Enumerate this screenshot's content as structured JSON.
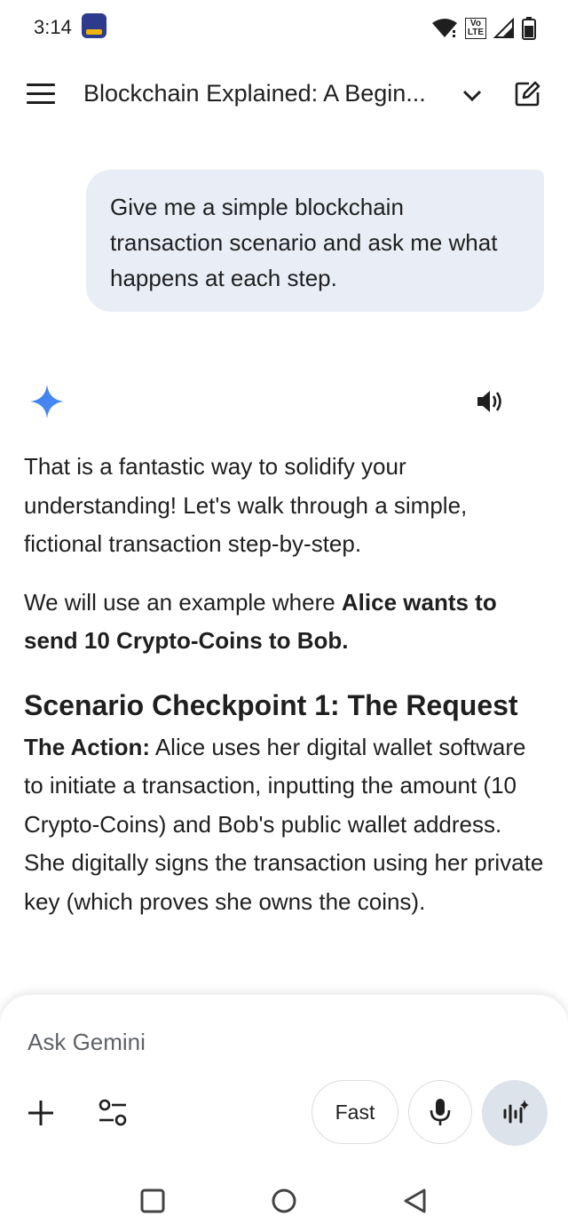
{
  "status_bar": {
    "time": "3:14",
    "icons": [
      "notification-app-icon",
      "wifi-icon",
      "volte-icon",
      "signal-icon",
      "battery-icon"
    ],
    "volte_label": "Vo LTE"
  },
  "app_bar": {
    "title": "Blockchain Explained: A Begin...",
    "icons": [
      "menu-icon",
      "chevron-down-icon",
      "edit-icon"
    ]
  },
  "user_message": {
    "text": "Give me a simple blockchain transaction scenario and ask me what happens at each step."
  },
  "response": {
    "icons": [
      "gemini-spark-icon",
      "speaker-icon"
    ],
    "paragraph1": "That is a fantastic way to solidify your understanding! Let's walk through a simple, fictional transaction step-by-step.",
    "paragraph2_prefix": "We will use an example where ",
    "paragraph2_bold": "Alice wants to send 10 Crypto-Coins to Bob.",
    "heading": "Scenario Checkpoint 1: The Request",
    "action_label": "The Action:",
    "action_text": " Alice uses her digital wallet software to initiate a transaction, inputting the amount (10 Crypto-Coins) and Bob's public wallet address. She digitally signs the transaction using her private key (which proves she owns the coins)."
  },
  "input_panel": {
    "placeholder": "Ask Gemini",
    "mode_label": "Fast",
    "icons": [
      "plus-icon",
      "tools-icon",
      "mic-icon",
      "live-icon"
    ]
  },
  "nav_bar": {
    "icons": [
      "recents-icon",
      "home-icon",
      "back-icon"
    ]
  },
  "colors": {
    "bubble": "#e9eef6",
    "gemini_blue": "#4285f4",
    "live_button": "#dde3ea"
  }
}
